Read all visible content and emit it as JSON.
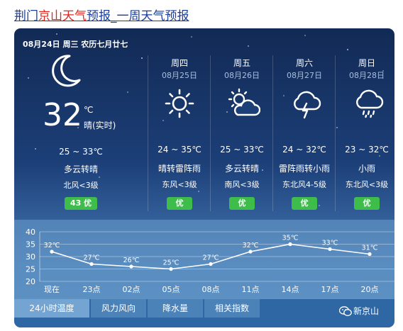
{
  "page": {
    "title_part1": "荆门",
    "title_highlight": "京山天气",
    "title_part2": "预报_一周天气预报"
  },
  "today": {
    "date_line": "08月24日 周三 农历七月廿七",
    "icon": "moon-icon",
    "temperature": "32",
    "unit": "℃",
    "state": "晴(实时)",
    "temp_range": "25 ~ 33℃",
    "description": "多云转晴",
    "wind": "北风<3级",
    "aqi": "43 优"
  },
  "forecast": [
    {
      "weekday": "周四",
      "date": "08月25日",
      "icon": "sun-icon",
      "temp_range": "24 ~ 35℃",
      "description": "晴转雷阵雨",
      "wind": "东风<3级",
      "aqi": "优"
    },
    {
      "weekday": "周五",
      "date": "08月26日",
      "icon": "partly-cloudy-icon",
      "temp_range": "25 ~ 33℃",
      "description": "多云转晴",
      "wind": "南风<3级",
      "aqi": "优"
    },
    {
      "weekday": "周六",
      "date": "08月27日",
      "icon": "thunderstorm-icon",
      "temp_range": "24 ~ 32℃",
      "description": "雷阵雨转小雨",
      "wind": "东北风4-5级",
      "aqi": "优"
    },
    {
      "weekday": "周日",
      "date": "08月28日",
      "icon": "rain-icon",
      "temp_range": "23 ~ 32℃",
      "description": "小雨",
      "wind": "东北风<3级",
      "aqi": "优"
    }
  ],
  "chart_data": {
    "type": "line",
    "title": "",
    "xlabel": "",
    "ylabel": "",
    "ylim": [
      20,
      40
    ],
    "yticks": [
      "40",
      "35",
      "30",
      "25",
      "20"
    ],
    "categories": [
      "现在",
      "23点",
      "02点",
      "05点",
      "08点",
      "11点",
      "14点",
      "17点",
      "20点"
    ],
    "series": [
      {
        "values": [
          32,
          27,
          26,
          25,
          27,
          32,
          35,
          33,
          31
        ]
      }
    ],
    "point_labels": [
      "32℃",
      "27℃",
      "26℃",
      "25℃",
      "27℃",
      "32℃",
      "35℃",
      "33℃",
      "31℃"
    ],
    "grid": true
  },
  "tabs": [
    "24小时温度",
    "风力风向",
    "降水量",
    "相关指数"
  ],
  "active_tab": "24小时温度",
  "brand": {
    "icon": "wechat-icon",
    "label": "新京山"
  },
  "colors": {
    "aqi_good": "#3ebd4b",
    "accent_red": "#e0271f",
    "link_blue": "#1a3d99"
  }
}
